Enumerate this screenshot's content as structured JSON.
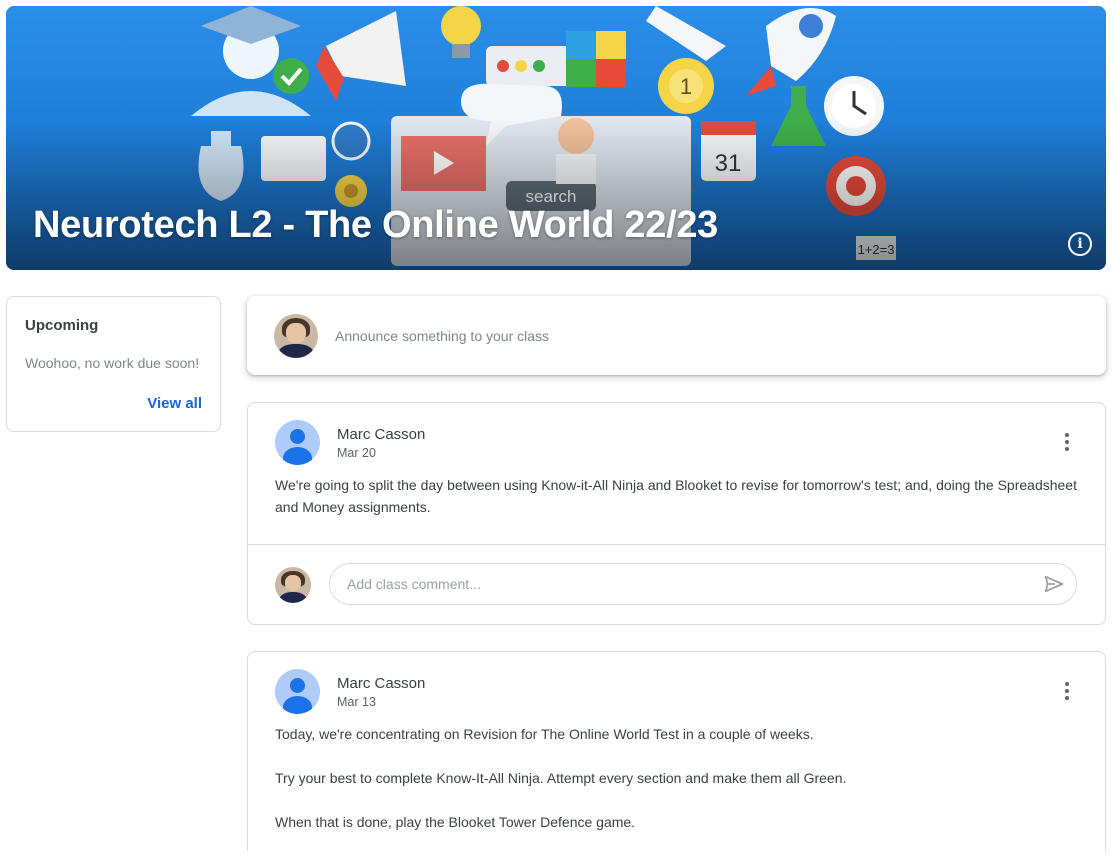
{
  "banner": {
    "title": "Neurotech L2 - The Online World 22/23"
  },
  "upcoming": {
    "title": "Upcoming",
    "empty_message": "Woohoo, no work due soon!",
    "view_all": "View all"
  },
  "announce": {
    "placeholder": "Announce something to your class"
  },
  "posts": [
    {
      "author": "Marc Casson",
      "date": "Mar 20",
      "body": [
        "We're going to split the day between using Know-it-All Ninja and Blooket to revise for tomorrow's test; and, doing the Spreadsheet and Money assignments."
      ],
      "comment_placeholder": "Add class comment..."
    },
    {
      "author": "Marc Casson",
      "date": "Mar 13",
      "body": [
        "Today, we're concentrating on Revision for The Online World Test in a couple of weeks.",
        "Try your best to complete Know-It-All Ninja. Attempt every section and make them all Green.",
        "When that is done, play the Blooket Tower Defence game."
      ]
    }
  ],
  "colors": {
    "accent": "#1967d2",
    "banner_blue": "#1f7fd9",
    "border": "#dadce0"
  },
  "icons": {
    "info": "info-icon",
    "more": "more-vert-icon",
    "send": "send-icon"
  }
}
